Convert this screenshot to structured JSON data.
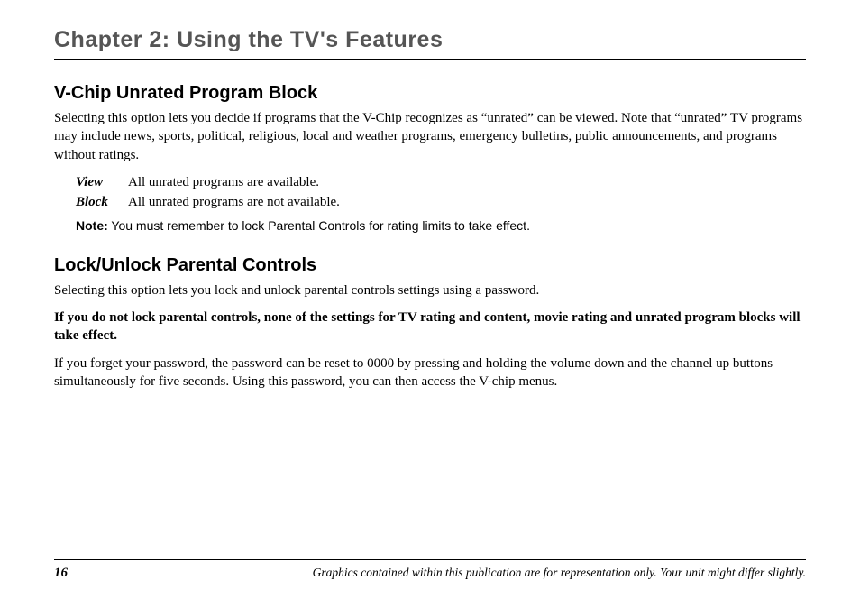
{
  "chapter_title": "Chapter 2: Using the TV's Features",
  "section1": {
    "heading": "V-Chip Unrated Program Block",
    "intro": "Selecting this option lets you decide if programs that the V-Chip recognizes as “unrated” can be viewed. Note that “unrated” TV programs may include news, sports, political, religious, local and weather programs, emergency bulletins, public announcements, and programs without ratings.",
    "defs": [
      {
        "term": "View",
        "desc": "All unrated programs are available."
      },
      {
        "term": "Block",
        "desc": "All unrated programs are not available."
      }
    ],
    "note_label": "Note:",
    "note_text": "You must remember to lock Parental Controls for rating limits to take effect."
  },
  "section2": {
    "heading": "Lock/Unlock Parental Controls",
    "p1": "Selecting this option lets you lock and unlock parental controls settings using a password.",
    "p2": "If you do not lock parental controls, none of the settings for TV rating and content, movie rating and unrated program blocks will take effect.",
    "p3": "If you forget your password, the password can be reset to 0000 by pressing and holding the volume down and the channel up buttons simultaneously for five seconds. Using this password, you can then access the V-chip menus."
  },
  "footer": {
    "page_num": "16",
    "text": "Graphics contained within this publication are for representation only. Your unit might differ slightly."
  }
}
